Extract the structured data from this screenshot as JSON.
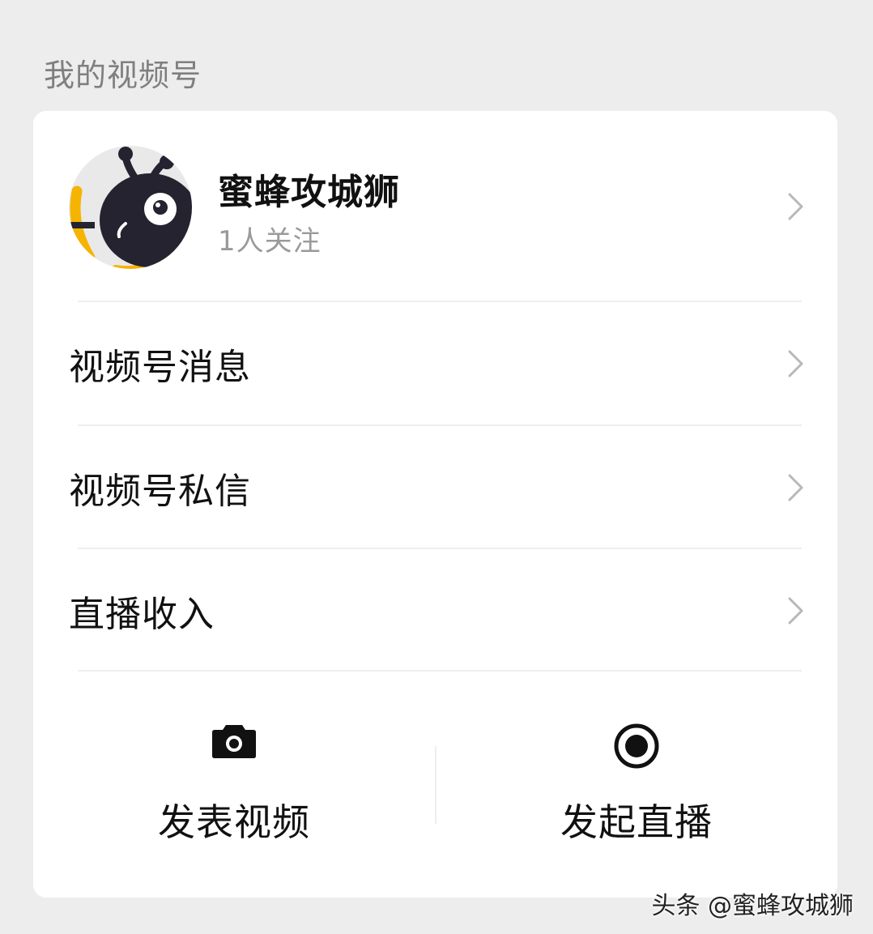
{
  "section": {
    "title": "我的视频号"
  },
  "profile": {
    "name": "蜜蜂攻城狮",
    "followers": "1人关注",
    "avatar_icon": "bee-mascot-avatar"
  },
  "menu": {
    "items": [
      {
        "label": "视频号消息",
        "icon": "chevron-right-icon"
      },
      {
        "label": "视频号私信",
        "icon": "chevron-right-icon"
      },
      {
        "label": "直播收入",
        "icon": "chevron-right-icon"
      }
    ]
  },
  "actions": {
    "post_video": {
      "label": "发表视频",
      "icon": "camera-icon"
    },
    "go_live": {
      "label": "发起直播",
      "icon": "record-icon"
    }
  },
  "watermark": {
    "text": "头条 @蜜蜂攻城狮"
  },
  "colors": {
    "page_background": "#ededed",
    "card_background": "#ffffff",
    "secondary_text": "#9a9a9a",
    "chevron": "#b8b8b8",
    "avatar_yellow": "#f5b400",
    "avatar_dark": "#25232f"
  }
}
